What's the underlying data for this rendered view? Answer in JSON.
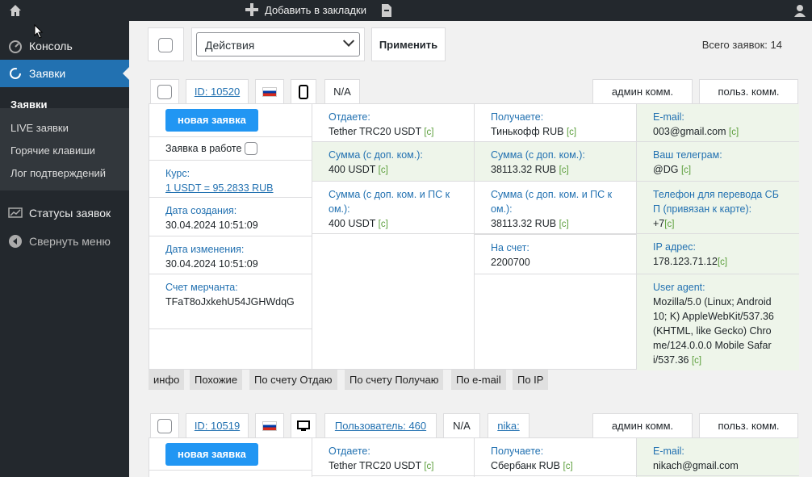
{
  "adminbar": {
    "add_bookmark": "Добавить в закладки"
  },
  "sidebar": {
    "console": "Консоль",
    "orders": "Заявки",
    "sub": [
      "Заявки",
      "LIVE заявки",
      "Горячие клавиши",
      "Лог подтверждений"
    ],
    "statuses": "Статусы заявок",
    "collapse": "Свернуть меню"
  },
  "toolbar": {
    "actions_value": "Действия",
    "apply": "Применить",
    "total": "Всего заявок: 14"
  },
  "orders": [
    {
      "id": "ID: 10520",
      "na": "N/A",
      "admin_comment": "админ комм.",
      "user_comment": "польз. комм.",
      "new_btn": "новая заявка",
      "in_work": "Заявка в работе",
      "rate_label": "Курс:",
      "rate_value": "1 USDT = 95.2833 RUB",
      "created_label": "Дата создания:",
      "created_value": "30.04.2024 10:51:09",
      "modified_label": "Дата изменения:",
      "modified_value": "30.04.2024 10:51:09",
      "merchant_label": "Счет мерчанта:",
      "merchant_value": "TFaT8oJxkehU54JGHWdqG",
      "give_label": "Отдаете:",
      "give_value": "Tether TRC20 USDT",
      "sum_fee_label": "Сумма (с доп. ком.):",
      "sum_fee_value": "400 USDT",
      "sum_ps_label": "Сумма (с доп. ком. и ПС к ом.):",
      "sum_ps_value": "400 USDT",
      "get_label": "Получаете:",
      "get_value": "Тинькофф RUB",
      "get_sum_fee_label": "Сумма (с доп. ком.):",
      "get_sum_fee_value": "38113.32 RUB",
      "get_sum_ps_label": "Сумма (с доп. ком. и ПС к ом.):",
      "get_sum_ps_value": "38113.32 RUB",
      "account_label": "На счет:",
      "account_value": "2200700",
      "email_label": "E-mail:",
      "email_value": "003@gmail.com",
      "tg_label": "Ваш телеграм:",
      "tg_value": "@DG",
      "phone_label": "Телефон для перевода СБ П (привязан к карте):",
      "phone_value": "+7",
      "ip_label": "IP адрес:",
      "ip_value": "178.123.71.12",
      "ua_label": "User agent:",
      "ua_value": "Mozilla/5.0 (Linux; Android 10; K) AppleWebKit/537.36 (KHTML, like Gecko) Chro me/124.0.0.0 Mobile Safar i/537.36"
    },
    {
      "id": "ID: 10519",
      "user": "Пользователь: 460",
      "na": "N/A",
      "nick": "nika:",
      "admin_comment": "админ комм.",
      "user_comment": "польз. комм.",
      "new_btn": "новая заявка",
      "give_label": "Отдаете:",
      "give_value": "Tether TRC20 USDT",
      "get_label": "Получаете:",
      "get_value": "Сбербанк RUB",
      "email_label": "E-mail:",
      "email_value": "nikach@gmail.com"
    }
  ],
  "copy_tag": "[c]",
  "footer_buttons": [
    "инфо",
    "Похожие",
    "По счету Отдаю",
    "По счету Получаю",
    "По e-mail",
    "По IP"
  ]
}
